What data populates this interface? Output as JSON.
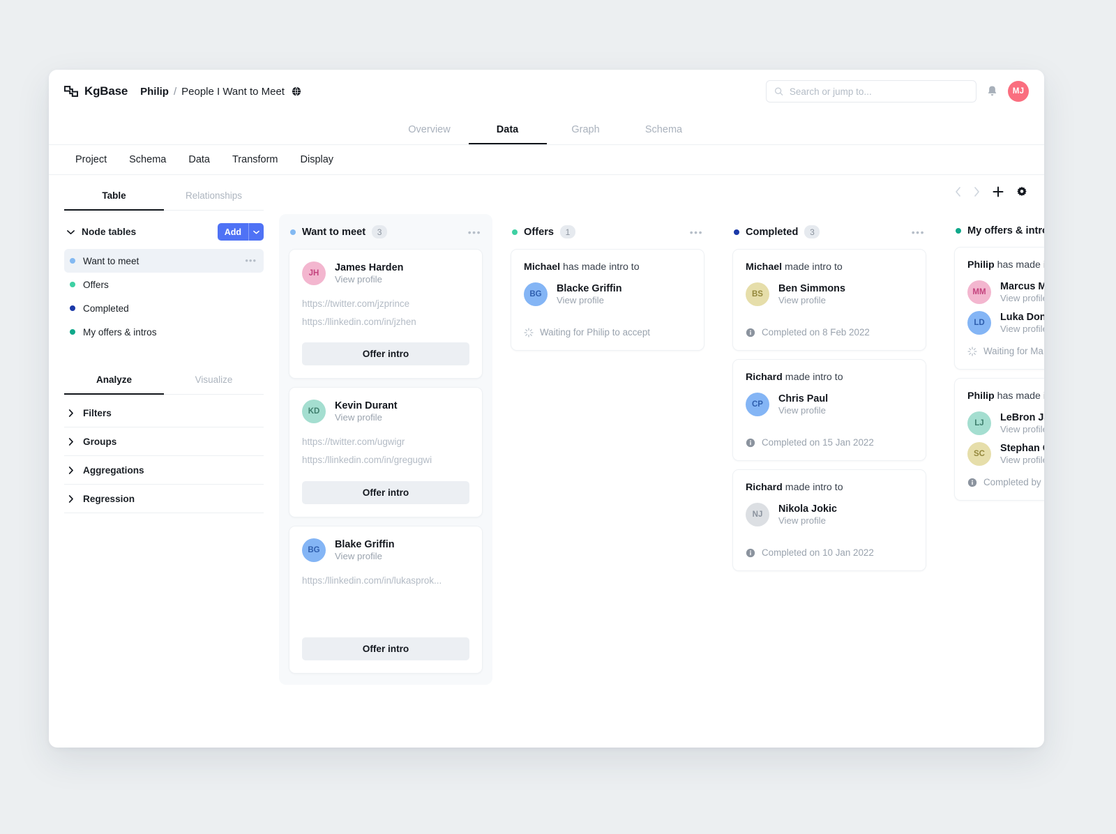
{
  "app": {
    "brand": "KgBase",
    "breadcrumb": {
      "owner": "Philip",
      "separator": "/",
      "title": "People I Want to Meet"
    }
  },
  "search": {
    "placeholder": "Search or jump to...",
    "value": ""
  },
  "user": {
    "initials": "MJ",
    "color": "#fa6e7f"
  },
  "main_tabs": [
    {
      "label": "Overview",
      "active": false
    },
    {
      "label": "Data",
      "active": true
    },
    {
      "label": "Graph",
      "active": false
    },
    {
      "label": "Schema",
      "active": false
    }
  ],
  "sub_nav": [
    "Project",
    "Schema",
    "Data",
    "Transform",
    "Display"
  ],
  "sidebar": {
    "tabs": [
      {
        "label": "Table",
        "active": true
      },
      {
        "label": "Relationships",
        "active": false
      }
    ],
    "node_tables_label": "Node tables",
    "add_label": "Add",
    "items": [
      {
        "label": "Want to meet",
        "color": "#83b9f2",
        "selected": true
      },
      {
        "label": "Offers",
        "color": "#3ed0a3",
        "selected": false
      },
      {
        "label": "Completed",
        "color": "#1b39a8",
        "selected": false
      },
      {
        "label": "My offers & intros",
        "color": "#0fa88a",
        "selected": false
      }
    ],
    "analyze_tabs": [
      {
        "label": "Analyze",
        "active": true
      },
      {
        "label": "Visualize",
        "active": false
      }
    ],
    "accordion": [
      "Filters",
      "Groups",
      "Aggregations",
      "Regression"
    ]
  },
  "board": {
    "columns": [
      {
        "title": "Want to meet",
        "count": "3",
        "dot": "#83b9f2",
        "tinted": true,
        "cards": [
          {
            "type": "person",
            "person": {
              "name": "James Harden",
              "sub": "View profile",
              "initials": "JH",
              "bg": "#f3b6cf",
              "fg": "#c4437e"
            },
            "links": [
              "https://twitter.com/jzprince",
              "https:/llinkedin.com/in/jzhen"
            ],
            "action": "Offer intro"
          },
          {
            "type": "person",
            "person": {
              "name": "Kevin Durant",
              "sub": "View profile",
              "initials": "KD",
              "bg": "#a4ded0",
              "fg": "#3f7f6e"
            },
            "links": [
              "https://twitter.com/ugwigr",
              "https:/llinkedin.com/in/gregugwi"
            ],
            "action": "Offer intro"
          },
          {
            "type": "person",
            "person": {
              "name": "Blake Griffin",
              "sub": "View profile",
              "initials": "BG",
              "bg": "#84b5f5",
              "fg": "#2f5fae"
            },
            "links": [
              "https:/llinkedin.com/in/lukasprok..."
            ],
            "action": "Offer intro"
          }
        ]
      },
      {
        "title": "Offers",
        "count": "1",
        "dot": "#3ed0a3",
        "tinted": false,
        "cards": [
          {
            "type": "intro",
            "actor": "Michael",
            "phrase": "has made intro to",
            "people": [
              {
                "name": "Blacke Griffin",
                "sub": "View profile",
                "initials": "BG",
                "bg": "#84b5f5",
                "fg": "#2f5fae"
              }
            ],
            "status": "Waiting for Philip to accept",
            "status_icon": "spinner-icon"
          }
        ]
      },
      {
        "title": "Completed",
        "count": "3",
        "dot": "#1b39a8",
        "tinted": false,
        "cards": [
          {
            "type": "intro",
            "actor": "Michael",
            "phrase": "made intro to",
            "people": [
              {
                "name": "Ben Simmons",
                "sub": "View profile",
                "initials": "BS",
                "bg": "#e6deaa",
                "fg": "#94883c"
              }
            ],
            "status": "Completed on 8 Feb 2022",
            "status_icon": "info-icon"
          },
          {
            "type": "intro",
            "actor": "Richard",
            "phrase": "made intro to",
            "people": [
              {
                "name": "Chris Paul",
                "sub": "View profile",
                "initials": "CP",
                "bg": "#84b5f5",
                "fg": "#2f5fae"
              }
            ],
            "status": "Completed on 15 Jan 2022",
            "status_icon": "info-icon"
          },
          {
            "type": "intro",
            "actor": "Richard",
            "phrase": "made intro to",
            "people": [
              {
                "name": "Nikola Jokic",
                "sub": "View profile",
                "initials": "NJ",
                "bg": "#dcdfe3",
                "fg": "#8b939e"
              }
            ],
            "status": "Completed on 10 Jan 2022",
            "status_icon": "info-icon"
          }
        ]
      },
      {
        "title": "My offers & intros",
        "count": "",
        "dot": "#0fa88a",
        "tinted": false,
        "cards": [
          {
            "type": "intro",
            "actor": "Philip",
            "phrase": "has made intro to",
            "people": [
              {
                "name": "Marcus Mu",
                "sub": "View profile",
                "initials": "MM",
                "bg": "#f3b6cf",
                "fg": "#c4437e"
              },
              {
                "name": "Luka Doncic",
                "sub": "View profile",
                "initials": "LD",
                "bg": "#84b5f5",
                "fg": "#2f5fae"
              }
            ],
            "status": "Waiting for Ma",
            "status_icon": "spinner-icon"
          },
          {
            "type": "intro",
            "actor": "Philip",
            "phrase": "has made intro to",
            "people": [
              {
                "name": "LeBron James",
                "sub": "View profile",
                "initials": "LJ",
                "bg": "#a4ded0",
                "fg": "#3f7f6e"
              },
              {
                "name": "Stephan Curry",
                "sub": "View profile",
                "initials": "SC",
                "bg": "#e6deaa",
                "fg": "#94883c"
              }
            ],
            "status": "Completed by",
            "status_icon": "info-icon"
          }
        ]
      }
    ]
  }
}
